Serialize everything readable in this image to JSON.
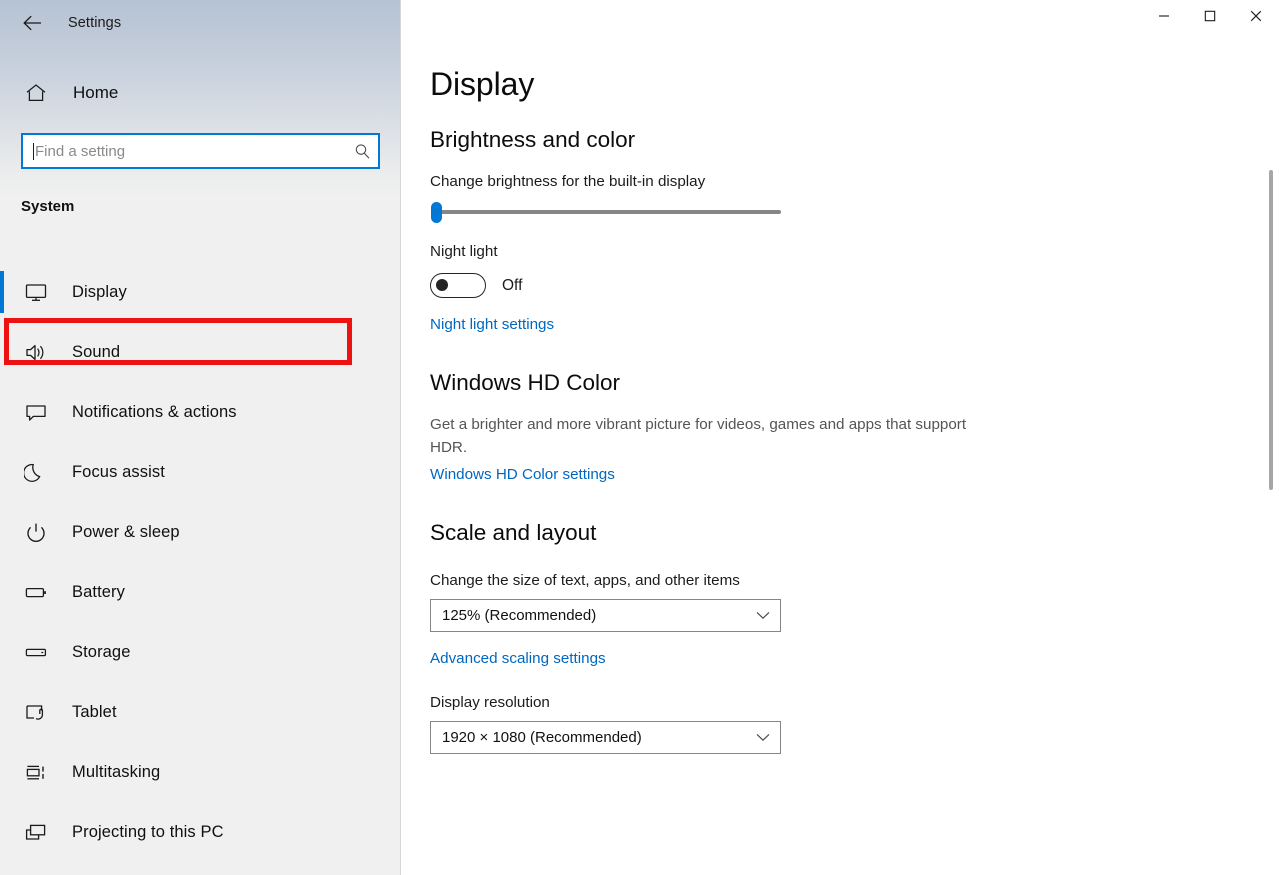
{
  "window": {
    "app_title": "Settings",
    "back_icon": "back-arrow-icon",
    "controls": {
      "minimize": "minimize-icon",
      "maximize": "maximize-icon",
      "close": "close-icon"
    }
  },
  "sidebar": {
    "home_label": "Home",
    "home_icon": "home-icon",
    "search": {
      "placeholder": "Find a setting",
      "value": "",
      "icon": "search-icon",
      "focused": true,
      "focus_color": "#0078d4"
    },
    "group_label": "System",
    "selected_accent_color": "#0078d4",
    "items": [
      {
        "label": "Display",
        "icon": "monitor-icon",
        "selected": true,
        "annotated": false
      },
      {
        "label": "Sound",
        "icon": "speaker-icon",
        "selected": false,
        "annotated": true
      },
      {
        "label": "Notifications & actions",
        "icon": "chat-bubble-icon",
        "selected": false,
        "annotated": false
      },
      {
        "label": "Focus assist",
        "icon": "moon-icon",
        "selected": false,
        "annotated": false
      },
      {
        "label": "Power & sleep",
        "icon": "power-icon",
        "selected": false,
        "annotated": false
      },
      {
        "label": "Battery",
        "icon": "battery-icon",
        "selected": false,
        "annotated": false
      },
      {
        "label": "Storage",
        "icon": "storage-icon",
        "selected": false,
        "annotated": false
      },
      {
        "label": "Tablet",
        "icon": "tablet-icon",
        "selected": false,
        "annotated": false
      },
      {
        "label": "Multitasking",
        "icon": "multitasking-icon",
        "selected": false,
        "annotated": false
      },
      {
        "label": "Projecting to this PC",
        "icon": "projecting-icon",
        "selected": false,
        "annotated": false
      }
    ]
  },
  "annotation": {
    "color": "#ee1111",
    "target": "Sound"
  },
  "main": {
    "page_title": "Display",
    "brightness_section": {
      "heading": "Brightness and color",
      "slider_label": "Change brightness for the built-in display",
      "slider_value_percent": 1,
      "night_light_label": "Night light",
      "night_light_state": "Off",
      "night_light_on": false,
      "night_light_link": "Night light settings"
    },
    "hd_color_section": {
      "heading": "Windows HD Color",
      "description": "Get a brighter and more vibrant picture for videos, games and apps that support HDR.",
      "link": "Windows HD Color settings"
    },
    "scale_section": {
      "heading": "Scale and layout",
      "scale_label": "Change the size of text, apps, and other items",
      "scale_value": "125% (Recommended)",
      "scale_link": "Advanced scaling settings",
      "resolution_label": "Display resolution",
      "resolution_value": "1920 × 1080 (Recommended)"
    }
  }
}
